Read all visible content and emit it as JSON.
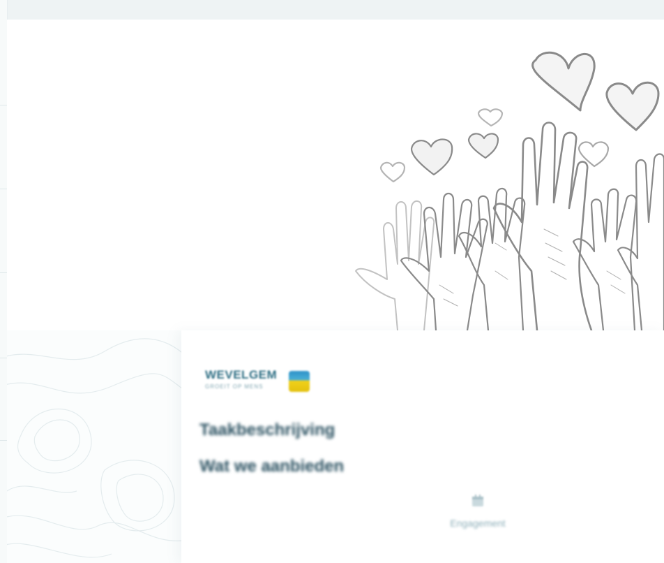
{
  "page": {
    "logo": {
      "wordmark": "WEVELGEM",
      "tagline": "GROEIT OP MENS"
    },
    "sections": [
      {
        "title": "Taakbeschrijving"
      },
      {
        "title": "Wat we aanbieden"
      }
    ],
    "engagement": {
      "icon": "calendar-icon",
      "label": "Engagement"
    }
  },
  "colors": {
    "title": "#2b5161",
    "logo_blue": "#2f93c9",
    "logo_yellow": "#f0d11b",
    "muted": "#8fb0ba"
  }
}
